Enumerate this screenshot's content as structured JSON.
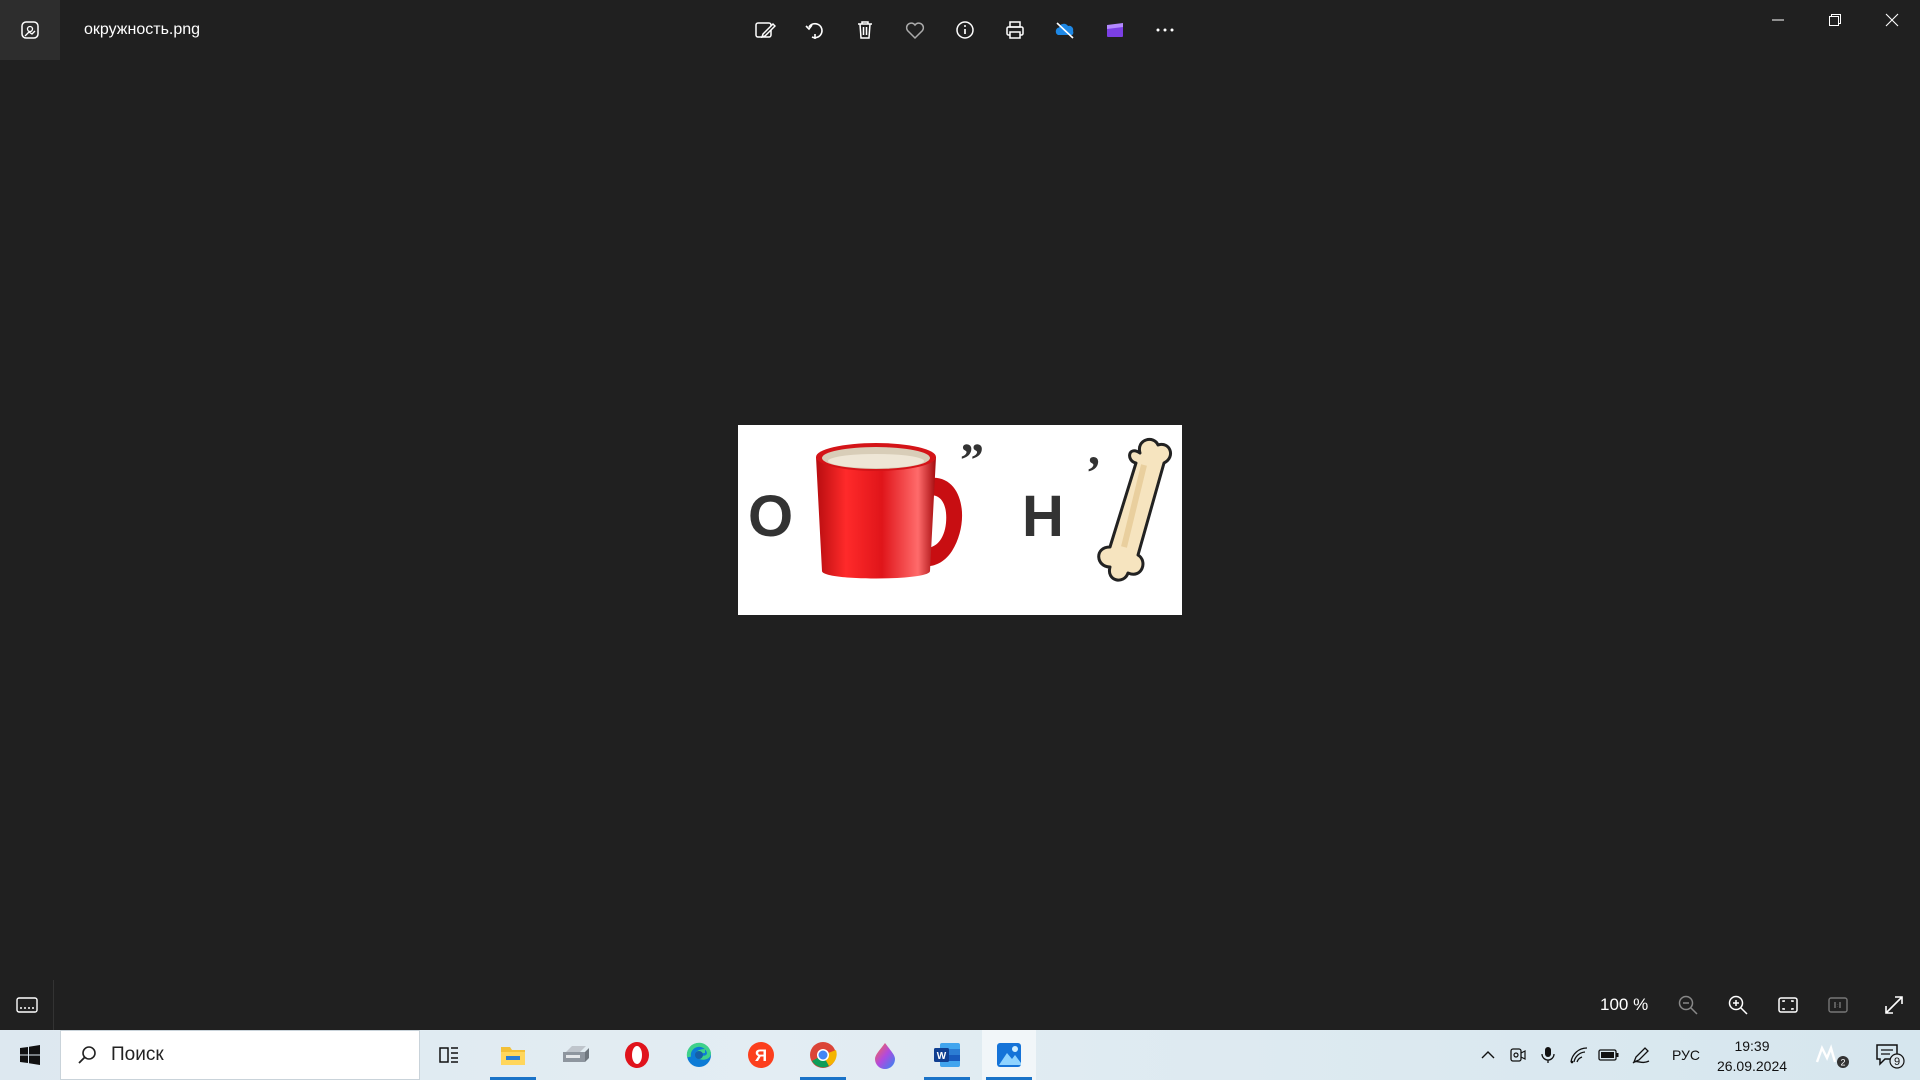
{
  "titlebar": {
    "filename": "окружность.png",
    "toolbar_icons": [
      "edit-image-icon",
      "rotate-icon",
      "delete-icon",
      "favorite-icon",
      "info-icon",
      "print-icon",
      "onedrive-icon",
      "video-editor-icon",
      "more-icon"
    ]
  },
  "picture": {
    "letter_o": "O",
    "quote_1": "”",
    "letter_h": "Н",
    "quote_2": ","
  },
  "statusbar": {
    "zoom": "100 %"
  },
  "taskbar": {
    "search_placeholder": "Поиск",
    "apps": [
      "task-view",
      "file-explorer",
      "fax-scanner",
      "opera",
      "edge",
      "yandex",
      "chrome",
      "paint3d",
      "word",
      "photos"
    ],
    "language": "РУС",
    "time": "19:39",
    "date": "26.09.2024",
    "notification_count": "9",
    "badge_count": "2"
  },
  "colors": {
    "background": "#202020",
    "accent": "#1a73c8",
    "mug_red": "#e0151a",
    "bone": "#f6e4bf"
  }
}
